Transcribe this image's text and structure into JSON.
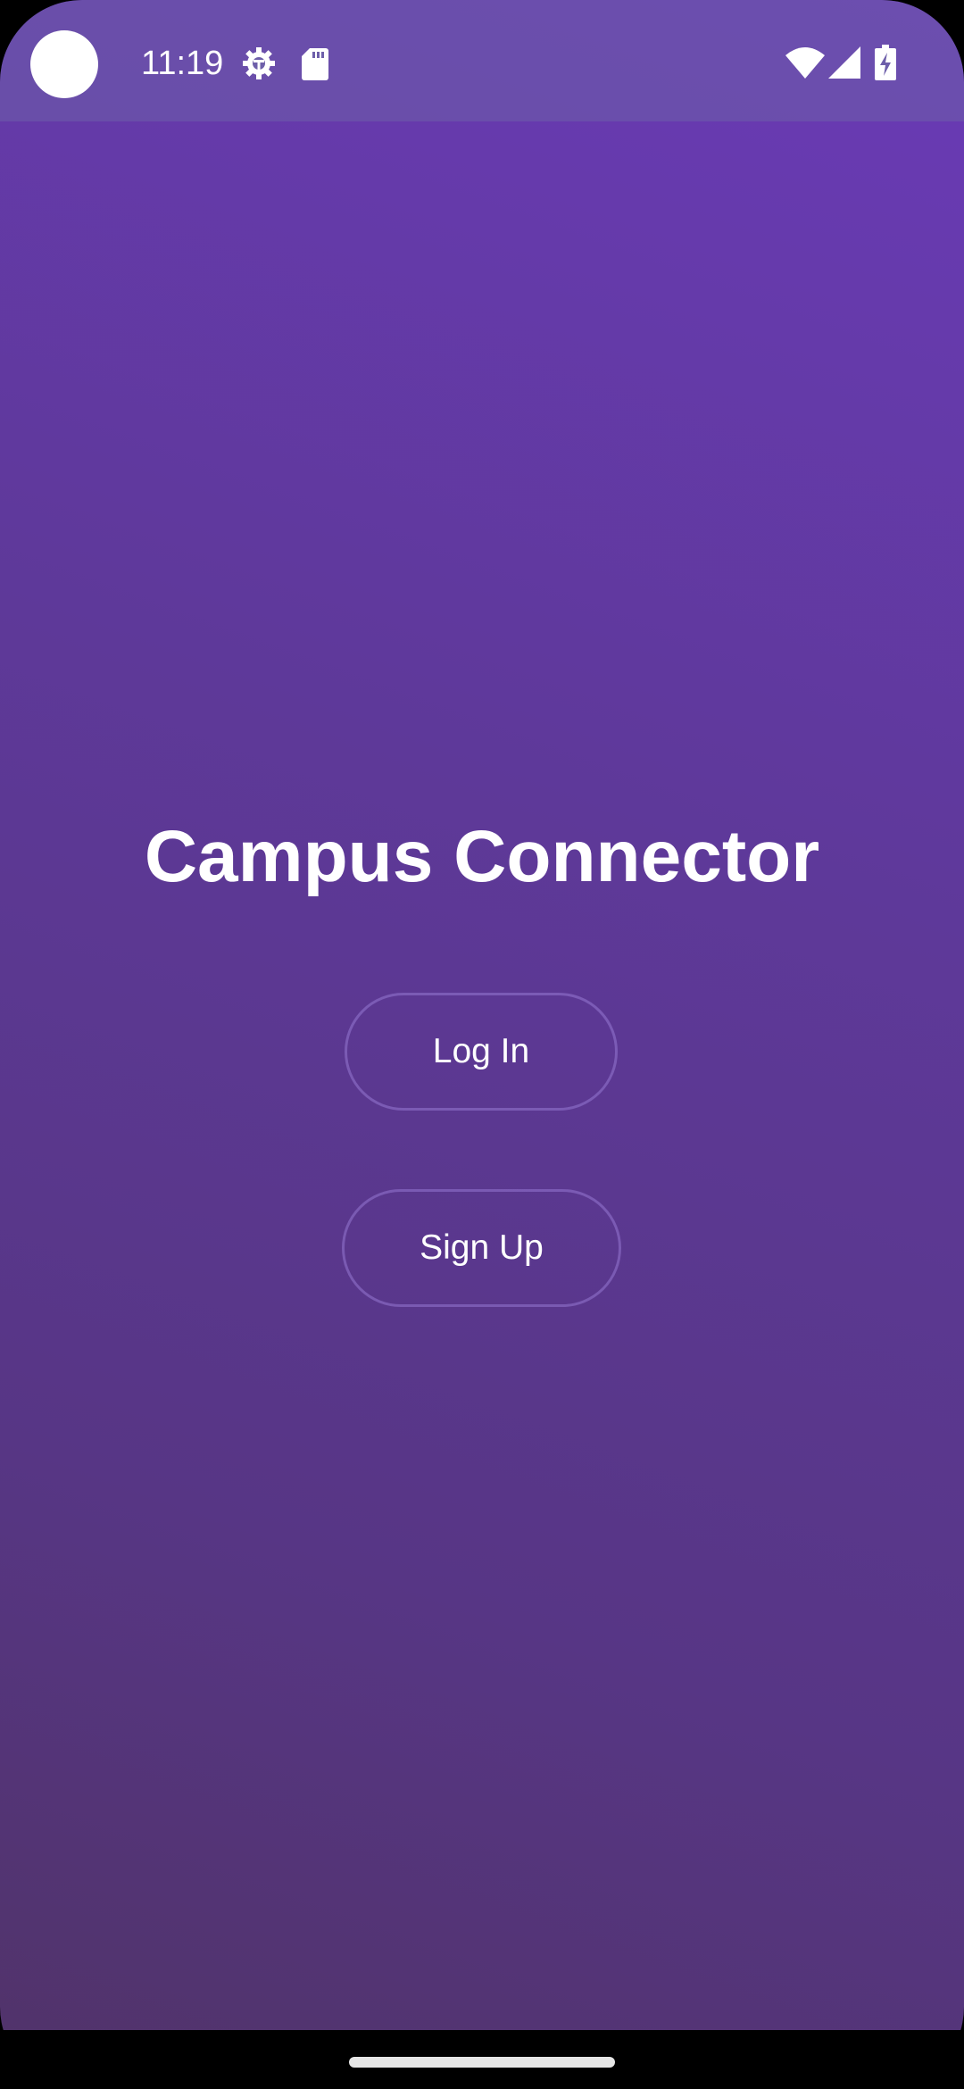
{
  "status_bar": {
    "time": "11:19",
    "icons": [
      "gear-icon",
      "sd-card-icon",
      "wifi-icon",
      "signal-icon",
      "battery-charging-icon"
    ]
  },
  "app": {
    "title": "Campus Connector",
    "login_label": "Log In",
    "signup_label": "Sign Up"
  },
  "colors": {
    "gradient_top": "#6a3ab6",
    "gradient_bottom": "#51336b",
    "text": "#ffffff",
    "button_border": "#9678d2"
  }
}
